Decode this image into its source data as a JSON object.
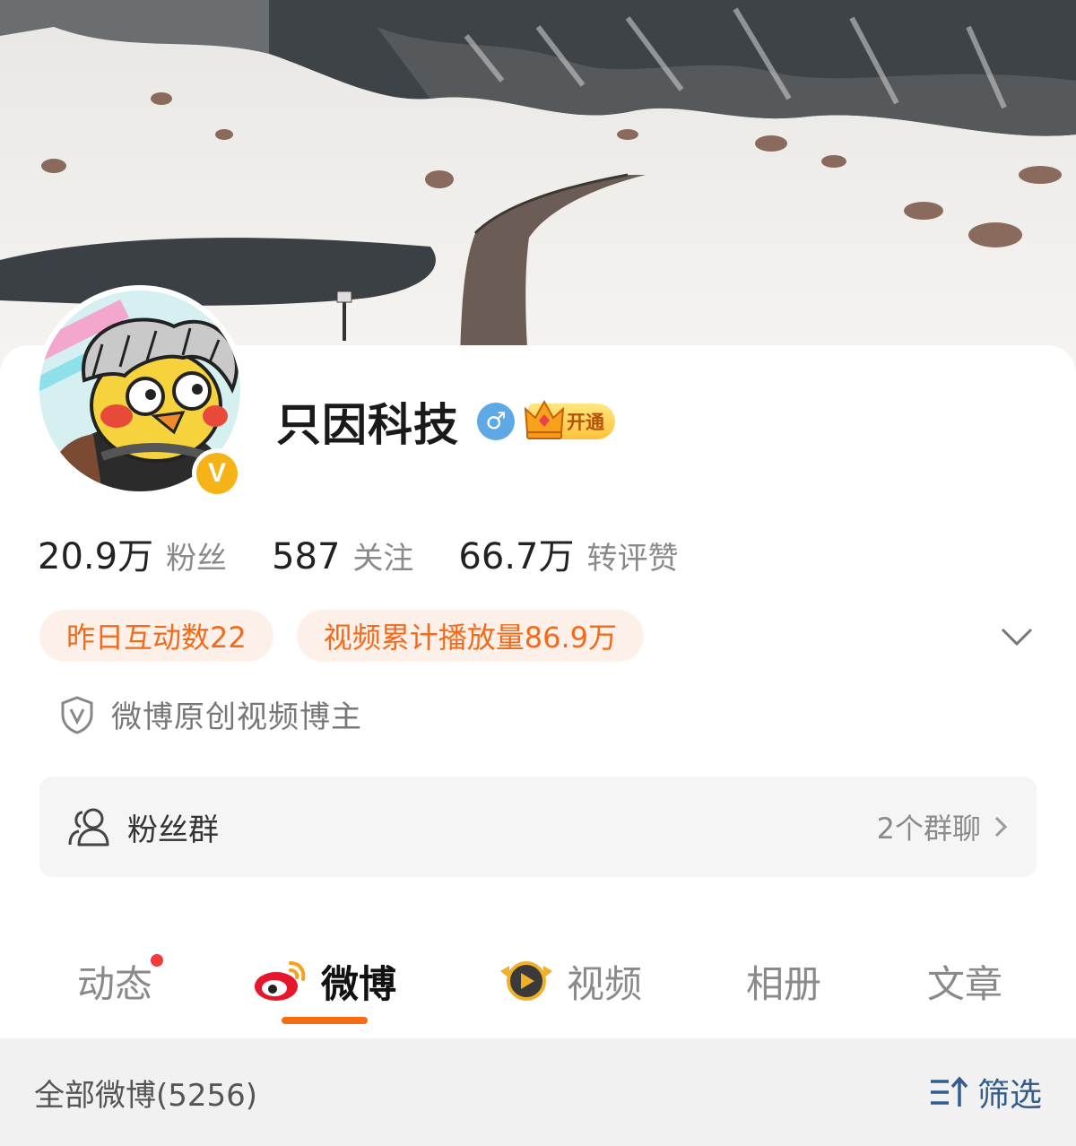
{
  "profile": {
    "name": "只因科技",
    "vip_label": "开通",
    "gender_symbol": "♂",
    "verified_mark": "V"
  },
  "stats": [
    {
      "value": "20.9万",
      "label": "粉丝"
    },
    {
      "value": "587",
      "label": "关注"
    },
    {
      "value": "66.7万",
      "label": "转评赞"
    }
  ],
  "highlights": [
    "昨日互动数22",
    "视频累计播放量86.9万"
  ],
  "certification": "微博原创视频博主",
  "fan_group": {
    "label": "粉丝群",
    "count": "2个群聊"
  },
  "tabs": [
    {
      "label": "动态",
      "has_dot": true
    },
    {
      "label": "微博",
      "active": true
    },
    {
      "label": "视频"
    },
    {
      "label": "相册"
    },
    {
      "label": "文章"
    }
  ],
  "feed_filter": {
    "all_label": "全部微博(5256)",
    "filter_label": "筛选"
  },
  "colors": {
    "accent_orange": "#f76b12",
    "pill_bg": "#fdf0e9",
    "pill_text": "#f26b1d",
    "filter_blue": "#345c8c",
    "gender_blue": "#5fa8e6",
    "verified_gold": "#f5b317"
  },
  "icons": {
    "gender": "male-icon",
    "vip": "crown-icon",
    "verified": "verified-v-icon",
    "expand": "chevron-down-icon",
    "cert": "shield-v-icon",
    "fans": "users-icon",
    "fans_chevron": "chevron-right-icon",
    "weibo_tab": "weibo-logo-icon",
    "video_tab": "video-badge-icon",
    "filter": "filter-sort-icon"
  }
}
